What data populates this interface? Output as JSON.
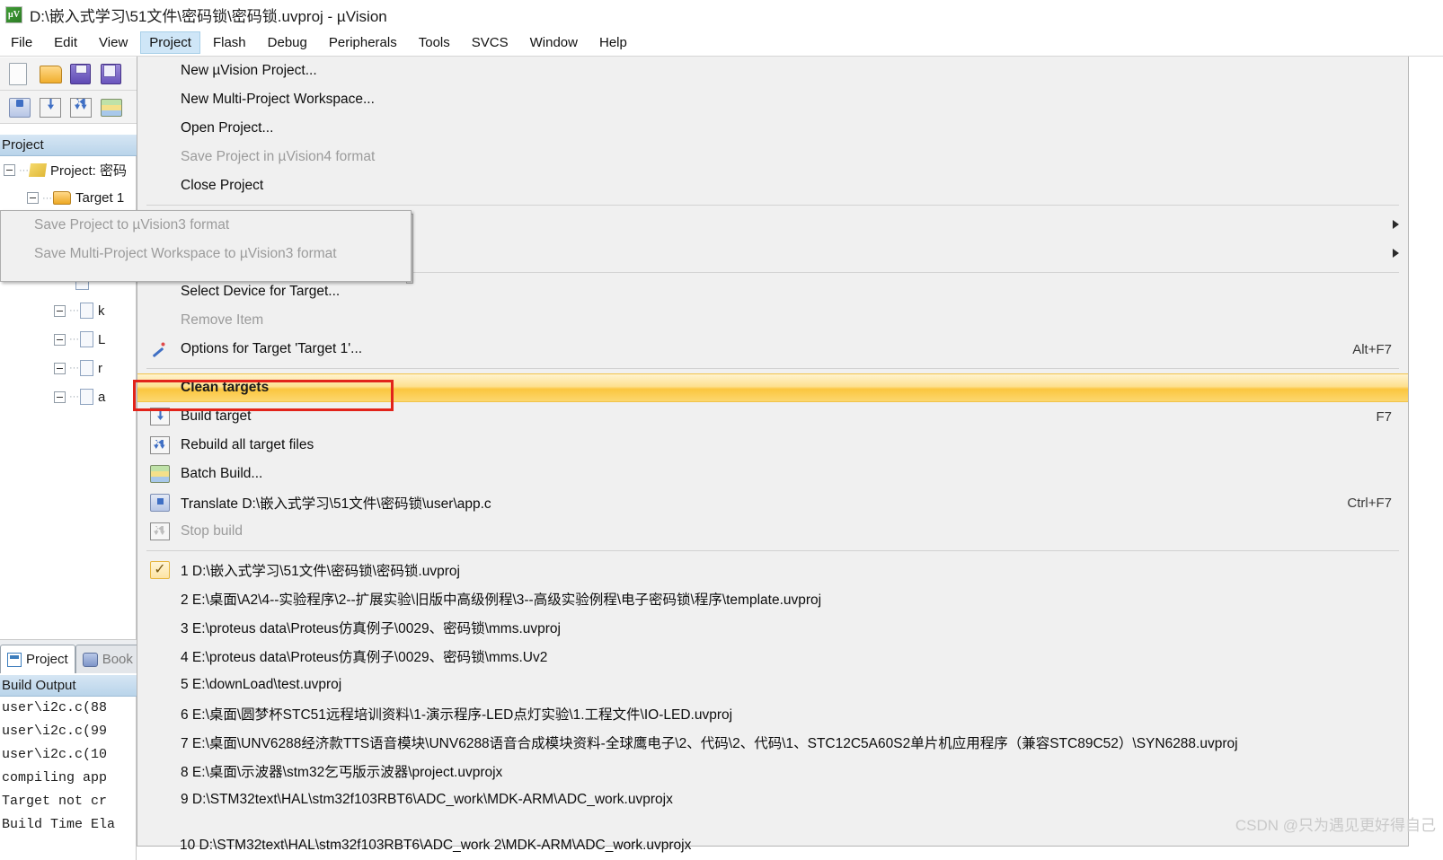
{
  "window": {
    "title": "D:\\嵌入式学习\\51文件\\密码锁\\密码锁.uvproj - µVision",
    "app_icon": "uvision-logo-icon"
  },
  "menubar": {
    "items": [
      {
        "label": "File",
        "active": false
      },
      {
        "label": "Edit",
        "active": false
      },
      {
        "label": "View",
        "active": false
      },
      {
        "label": "Project",
        "active": true
      },
      {
        "label": "Flash",
        "active": false
      },
      {
        "label": "Debug",
        "active": false
      },
      {
        "label": "Peripherals",
        "active": false
      },
      {
        "label": "Tools",
        "active": false
      },
      {
        "label": "SVCS",
        "active": false
      },
      {
        "label": "Window",
        "active": false
      },
      {
        "label": "Help",
        "active": false
      }
    ]
  },
  "toolbar": {
    "row1": [
      "new-file-icon",
      "open-folder-icon",
      "save-icon",
      "save-all-icon"
    ],
    "row2": [
      "translate-icon",
      "build-target-icon",
      "rebuild-all-icon",
      "batch-build-icon"
    ]
  },
  "project_panel": {
    "header": "Project",
    "tree": [
      {
        "label": "Project: 密码",
        "icon": "project-node-icon",
        "indent": 0
      },
      {
        "label": "Target 1",
        "icon": "target-folder-icon",
        "indent": 1
      }
    ],
    "hidden_files": [
      "k",
      "L",
      "r",
      "a"
    ]
  },
  "bottom_tabs": [
    {
      "label": "Project",
      "icon": "project-tab-icon",
      "selected": true
    },
    {
      "label": "Book",
      "icon": "books-tab-icon",
      "selected": false
    }
  ],
  "build_output": {
    "header": "Build Output",
    "lines": [
      "user\\i2c.c(88",
      "user\\i2c.c(99",
      "user\\i2c.c(10",
      "compiling app",
      "Target not cr",
      "Build Time Ela"
    ]
  },
  "ghost_artifacts": {
    "close_project_text": "Close Project",
    "panel_items": [
      "Save Project to µVision3 format",
      "Save Multi-Project Workspace to µVision3 format"
    ]
  },
  "project_menu": {
    "groups": [
      {
        "items": [
          {
            "label": "New µVision Project...",
            "icon": "",
            "accel": "",
            "disabled": false,
            "submenu": false,
            "highlight": false
          },
          {
            "label": "New Multi-Project Workspace...",
            "icon": "",
            "accel": "",
            "disabled": false,
            "submenu": false,
            "highlight": false
          },
          {
            "label": "Open Project...",
            "icon": "",
            "accel": "",
            "disabled": false,
            "submenu": false,
            "highlight": false
          },
          {
            "label": "Save Project in µVision4 format",
            "icon": "",
            "accel": "",
            "disabled": true,
            "submenu": false,
            "highlight": false
          },
          {
            "label": "Close Project",
            "icon": "",
            "accel": "",
            "disabled": false,
            "submenu": false,
            "highlight": false
          }
        ]
      },
      {
        "items": [
          {
            "label": "",
            "icon": "",
            "accel": "",
            "disabled": true,
            "submenu": true,
            "highlight": false
          },
          {
            "label": "",
            "icon": "",
            "accel": "",
            "disabled": true,
            "submenu": true,
            "highlight": false
          }
        ]
      },
      {
        "items": [
          {
            "label": "Select Device for Target...",
            "icon": "",
            "accel": "",
            "disabled": false,
            "submenu": false,
            "highlight": false
          },
          {
            "label": "Remove Item",
            "icon": "",
            "accel": "",
            "disabled": true,
            "submenu": false,
            "highlight": false
          },
          {
            "label": "Options for Target 'Target 1'...",
            "icon": "mi-wand",
            "accel": "Alt+F7",
            "disabled": false,
            "submenu": false,
            "highlight": false
          }
        ]
      },
      {
        "items": [
          {
            "label": "Clean targets",
            "icon": "",
            "accel": "",
            "disabled": false,
            "submenu": false,
            "highlight": true
          },
          {
            "label": "Build target",
            "icon": "mi-buildt",
            "accel": "F7",
            "disabled": false,
            "submenu": false,
            "highlight": false
          },
          {
            "label": "Rebuild all target files",
            "icon": "mi-rebuildt",
            "accel": "",
            "disabled": false,
            "submenu": false,
            "highlight": false
          },
          {
            "label": "Batch Build...",
            "icon": "mi-batch",
            "accel": "",
            "disabled": false,
            "submenu": false,
            "highlight": false
          },
          {
            "label": "Translate D:\\嵌入式学习\\51文件\\密码锁\\user\\app.c",
            "icon": "mi-translate",
            "accel": "Ctrl+F7",
            "disabled": false,
            "submenu": false,
            "highlight": false
          },
          {
            "label": "Stop build",
            "icon": "mi-stopb",
            "accel": "",
            "disabled": true,
            "submenu": false,
            "highlight": false
          }
        ]
      },
      {
        "items": [
          {
            "label": "1 D:\\嵌入式学习\\51文件\\密码锁\\密码锁.uvproj",
            "icon": "mi-check",
            "accel": "",
            "disabled": false,
            "submenu": false,
            "highlight": false
          },
          {
            "label": "2 E:\\桌面\\A2\\4--实验程序\\2--扩展实验\\旧版中高级例程\\3--高级实验例程\\电子密码锁\\程序\\template.uvproj",
            "icon": "",
            "accel": "",
            "disabled": false,
            "submenu": false,
            "highlight": false
          },
          {
            "label": "3 E:\\proteus data\\Proteus仿真例子\\0029、密码锁\\mms.uvproj",
            "icon": "",
            "accel": "",
            "disabled": false,
            "submenu": false,
            "highlight": false
          },
          {
            "label": "4 E:\\proteus data\\Proteus仿真例子\\0029、密码锁\\mms.Uv2",
            "icon": "",
            "accel": "",
            "disabled": false,
            "submenu": false,
            "highlight": false
          },
          {
            "label": "5 E:\\downLoad\\test.uvproj",
            "icon": "",
            "accel": "",
            "disabled": false,
            "submenu": false,
            "highlight": false
          },
          {
            "label": "6 E:\\桌面\\圆梦杯STC51远程培训资料\\1-演示程序-LED点灯实验\\1.工程文件\\IO-LED.uvproj",
            "icon": "",
            "accel": "",
            "disabled": false,
            "submenu": false,
            "highlight": false
          },
          {
            "label": "7 E:\\桌面\\UNV6288经济款TTS语音模块\\UNV6288语音合成模块资料-全球鹰电子\\2、代码\\2、代码\\1、STC12C5A60S2单片机应用程序（兼容STC89C52）\\SYN6288.uvproj",
            "icon": "",
            "accel": "",
            "disabled": false,
            "submenu": false,
            "highlight": false
          },
          {
            "label": "8 E:\\桌面\\示波器\\stm32乞丐版示波器\\project.uvprojx",
            "icon": "",
            "accel": "",
            "disabled": false,
            "submenu": false,
            "highlight": false
          },
          {
            "label": "9 D:\\STM32text\\HAL\\stm32f103RBT6\\ADC_work\\MDK-ARM\\ADC_work.uvprojx",
            "icon": "",
            "accel": "",
            "disabled": false,
            "submenu": false,
            "highlight": false
          }
        ]
      }
    ],
    "clipped_item": "10 D:\\STM32text\\HAL\\stm32f103RBT6\\ADC_work 2\\MDK-ARM\\ADC_work.uvprojx"
  },
  "watermark": {
    "text": "CSDN @只为遇见更好得自己"
  },
  "colors": {
    "menu_bg": "#f0f0f0",
    "highlight_gold": "#fbc63f",
    "redbox": "#e2231a",
    "panel_header": "#b9d4ea",
    "active_menu": "#cfe6f7"
  }
}
